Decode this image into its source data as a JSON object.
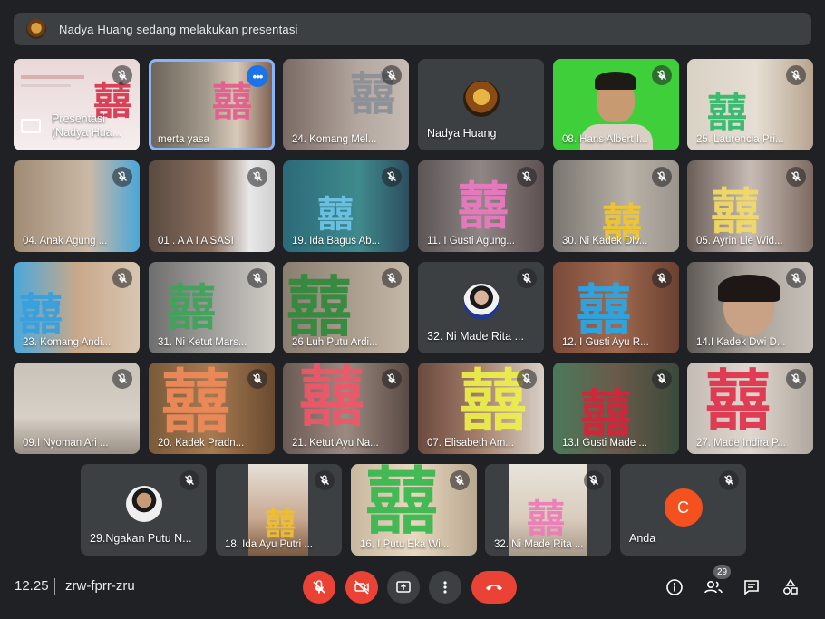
{
  "banner": {
    "text": "Nadya Huang sedang melakukan presentasi"
  },
  "tiles": [
    {
      "name": "Presentasi (Nadya Hua..."
    },
    {
      "name": "merta yasa"
    },
    {
      "name": "24. Komang Mel..."
    },
    {
      "name": "Nadya Huang"
    },
    {
      "name": "08. Hans Albert I..."
    },
    {
      "name": "25. Laurencia Pri..."
    },
    {
      "name": "04. Anak Agung ..."
    },
    {
      "name": "01 . A A I A SASI"
    },
    {
      "name": "19. Ida Bagus Ab..."
    },
    {
      "name": "11. I Gusti Agung..."
    },
    {
      "name": "30. Ni Kadek Div..."
    },
    {
      "name": "05. Ayrin Lie Wid..."
    },
    {
      "name": "23. Komang Andi..."
    },
    {
      "name": "31. Ni Ketut Mars..."
    },
    {
      "name": "26 Luh Putu Ardi..."
    },
    {
      "name": "32. Ni Made Rita ..."
    },
    {
      "name": "12. I Gusti Ayu R..."
    },
    {
      "name": "14.I Kadek Dwi D..."
    },
    {
      "name": "09.I Nyoman Ari ..."
    },
    {
      "name": "20. Kadek Pradn..."
    },
    {
      "name": "21. Ketut Ayu Na..."
    },
    {
      "name": "07. Elisabeth Am..."
    },
    {
      "name": "13.I Gusti Made ..."
    },
    {
      "name": "27. Made Indira P..."
    },
    {
      "name": "29.Ngakan Putu N..."
    },
    {
      "name": "18. Ida Ayu Putri ..."
    },
    {
      "name": "16. I Putu Eka Wi..."
    },
    {
      "name": "32. Ni Made Rita ..."
    },
    {
      "name": "Anda",
      "avatar_letter": "C"
    }
  ],
  "hanzi_char": "囍",
  "bottom": {
    "time": "12.25",
    "separator": "|",
    "meeting_code": "zrw-fprr-zru",
    "participant_count": "29"
  },
  "colors": {
    "background": "#202124",
    "tile": "#3c4043",
    "red": "#ea4335",
    "blue": "#1a73e8",
    "avatar_orange": "#f4511e"
  }
}
